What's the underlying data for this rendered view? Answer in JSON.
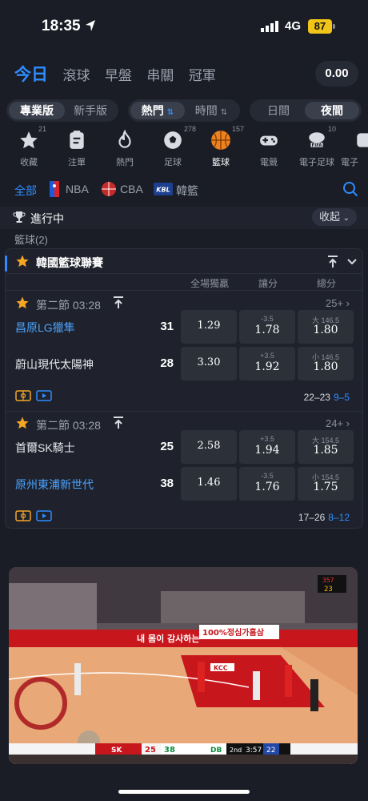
{
  "status_bar": {
    "time": "18:35",
    "network": "4G",
    "battery": "87"
  },
  "main_tabs": [
    {
      "label": "今日",
      "active": true
    },
    {
      "label": "滾球",
      "active": false
    },
    {
      "label": "早盤",
      "active": false
    },
    {
      "label": "串關",
      "active": false
    },
    {
      "label": "冠軍",
      "active": false
    }
  ],
  "balance": "0.00",
  "mode_seg": {
    "pro": "專業版",
    "novice": "新手版"
  },
  "sort_seg": {
    "hot": "熱門",
    "time": "時間",
    "sort_icon": "⇅"
  },
  "theme_seg": {
    "day": "日間",
    "night": "夜間"
  },
  "sports": [
    {
      "label": "收藏",
      "count": "21",
      "icon": "star-icon"
    },
    {
      "label": "注單",
      "count": "",
      "icon": "clipboard-icon"
    },
    {
      "label": "熱門",
      "count": "",
      "icon": "flame-icon"
    },
    {
      "label": "足球",
      "count": "278",
      "icon": "soccer-ball-icon"
    },
    {
      "label": "籃球",
      "count": "157",
      "icon": "basketball-icon"
    },
    {
      "label": "電競",
      "count": "",
      "icon": "gamepad-icon"
    },
    {
      "label": "電子足球",
      "count": "10",
      "icon": "fifa-icon"
    },
    {
      "label": "電子",
      "count": "",
      "icon": "esport-icon"
    }
  ],
  "leagues": {
    "all": "全部",
    "nba": "NBA",
    "cba": "CBA",
    "kbl": "韓籃"
  },
  "live_section": {
    "title": "進行中",
    "collapse": "收起",
    "subtitle": "籃球(2)"
  },
  "league_card": {
    "name": "韓國籃球聯賽",
    "col_moneyline": "全場獨贏",
    "col_spread": "讓分",
    "col_total": "總分"
  },
  "matches": [
    {
      "period": "第二節 03:28",
      "more": "25+",
      "home": {
        "name": "昌原LG獵隼",
        "score": "31",
        "ml": "1.29",
        "spread_line": "-3.5",
        "spread": "1.78",
        "total_line": "大 146.5",
        "total": "1.80"
      },
      "away": {
        "name": "蔚山現代太陽神",
        "score": "28",
        "ml": "3.30",
        "spread_line": "+3.5",
        "spread": "1.92",
        "total_line": "小 146.5",
        "total": "1.80"
      },
      "quarter": "22–23",
      "quarter_hl": "9–5"
    },
    {
      "period": "第二節 03:28",
      "more": "24+",
      "home": {
        "name": "首爾SK騎士",
        "score": "25",
        "ml": "2.58",
        "spread_line": "+3.5",
        "spread": "1.94",
        "total_line": "大 154.5",
        "total": "1.85"
      },
      "away": {
        "name": "原州東浦新世代",
        "score": "38",
        "ml": "1.46",
        "spread_line": "-3.5",
        "spread": "1.76",
        "total_line": "小 154.5",
        "total": "1.75"
      },
      "quarter": "17–26",
      "quarter_hl": "8–12"
    }
  ],
  "video": {
    "banner1": "100%정심가홈삼",
    "banner2": "내 몸이 감사하는",
    "score_home_team": "SK",
    "score_home": "25",
    "score_away_team": "DB",
    "score_away": "38",
    "quarter": "2nd",
    "clock": "3:57",
    "shot_clock": "22",
    "court_logo": "KCC"
  }
}
